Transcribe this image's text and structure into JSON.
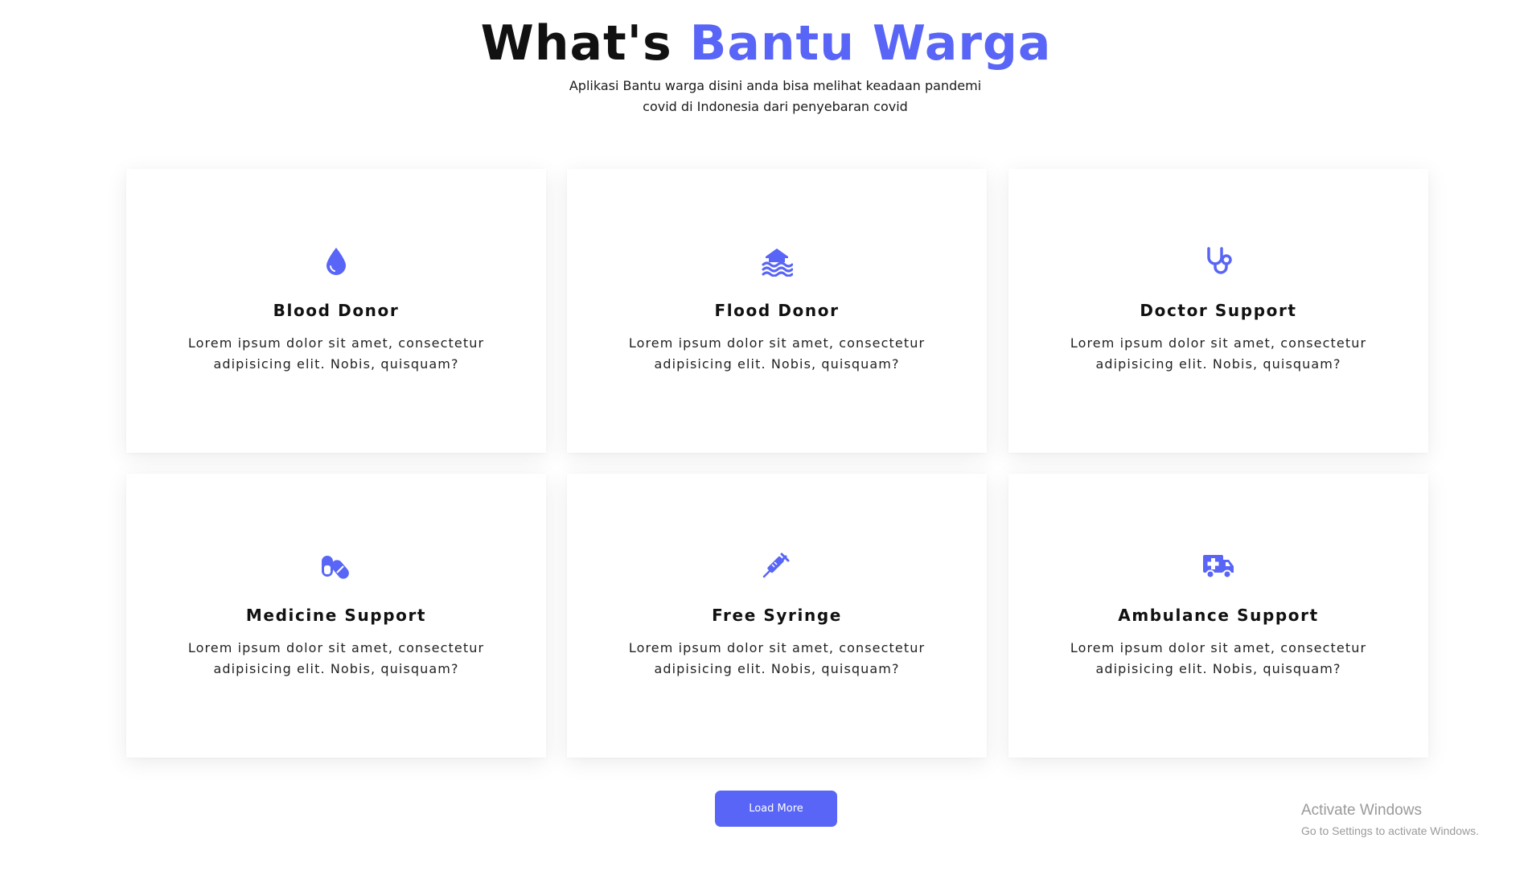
{
  "theme": {
    "accent": "#5865f6"
  },
  "header": {
    "title_prefix": "What's",
    "title_accent": "Bantu Warga",
    "subtitle": "Aplikasi Bantu warga disini anda bisa melihat keadaan pandemi covid di Indonesia dari penyebaran covid"
  },
  "cards": [
    {
      "icon": "blood-drop-icon",
      "title": "Blood Donor",
      "description": "Lorem ipsum dolor sit amet, consectetur adipisicing elit. Nobis, quisquam?"
    },
    {
      "icon": "flood-house-icon",
      "title": "Flood Donor",
      "description": "Lorem ipsum dolor sit amet, consectetur adipisicing elit. Nobis, quisquam?"
    },
    {
      "icon": "stethoscope-icon",
      "title": "Doctor Support",
      "description": "Lorem ipsum dolor sit amet, consectetur adipisicing elit. Nobis, quisquam?"
    },
    {
      "icon": "pills-icon",
      "title": "Medicine Support",
      "description": "Lorem ipsum dolor sit amet, consectetur adipisicing elit. Nobis, quisquam?"
    },
    {
      "icon": "syringe-icon",
      "title": "Free Syringe",
      "description": "Lorem ipsum dolor sit amet, consectetur adipisicing elit. Nobis, quisquam?"
    },
    {
      "icon": "ambulance-icon",
      "title": "Ambulance Support",
      "description": "Lorem ipsum dolor sit amet, consectetur adipisicing elit. Nobis, quisquam?"
    }
  ],
  "load_more_label": "Load More",
  "watermark": {
    "title": "Activate Windows",
    "subtitle": "Go to Settings to activate Windows."
  }
}
